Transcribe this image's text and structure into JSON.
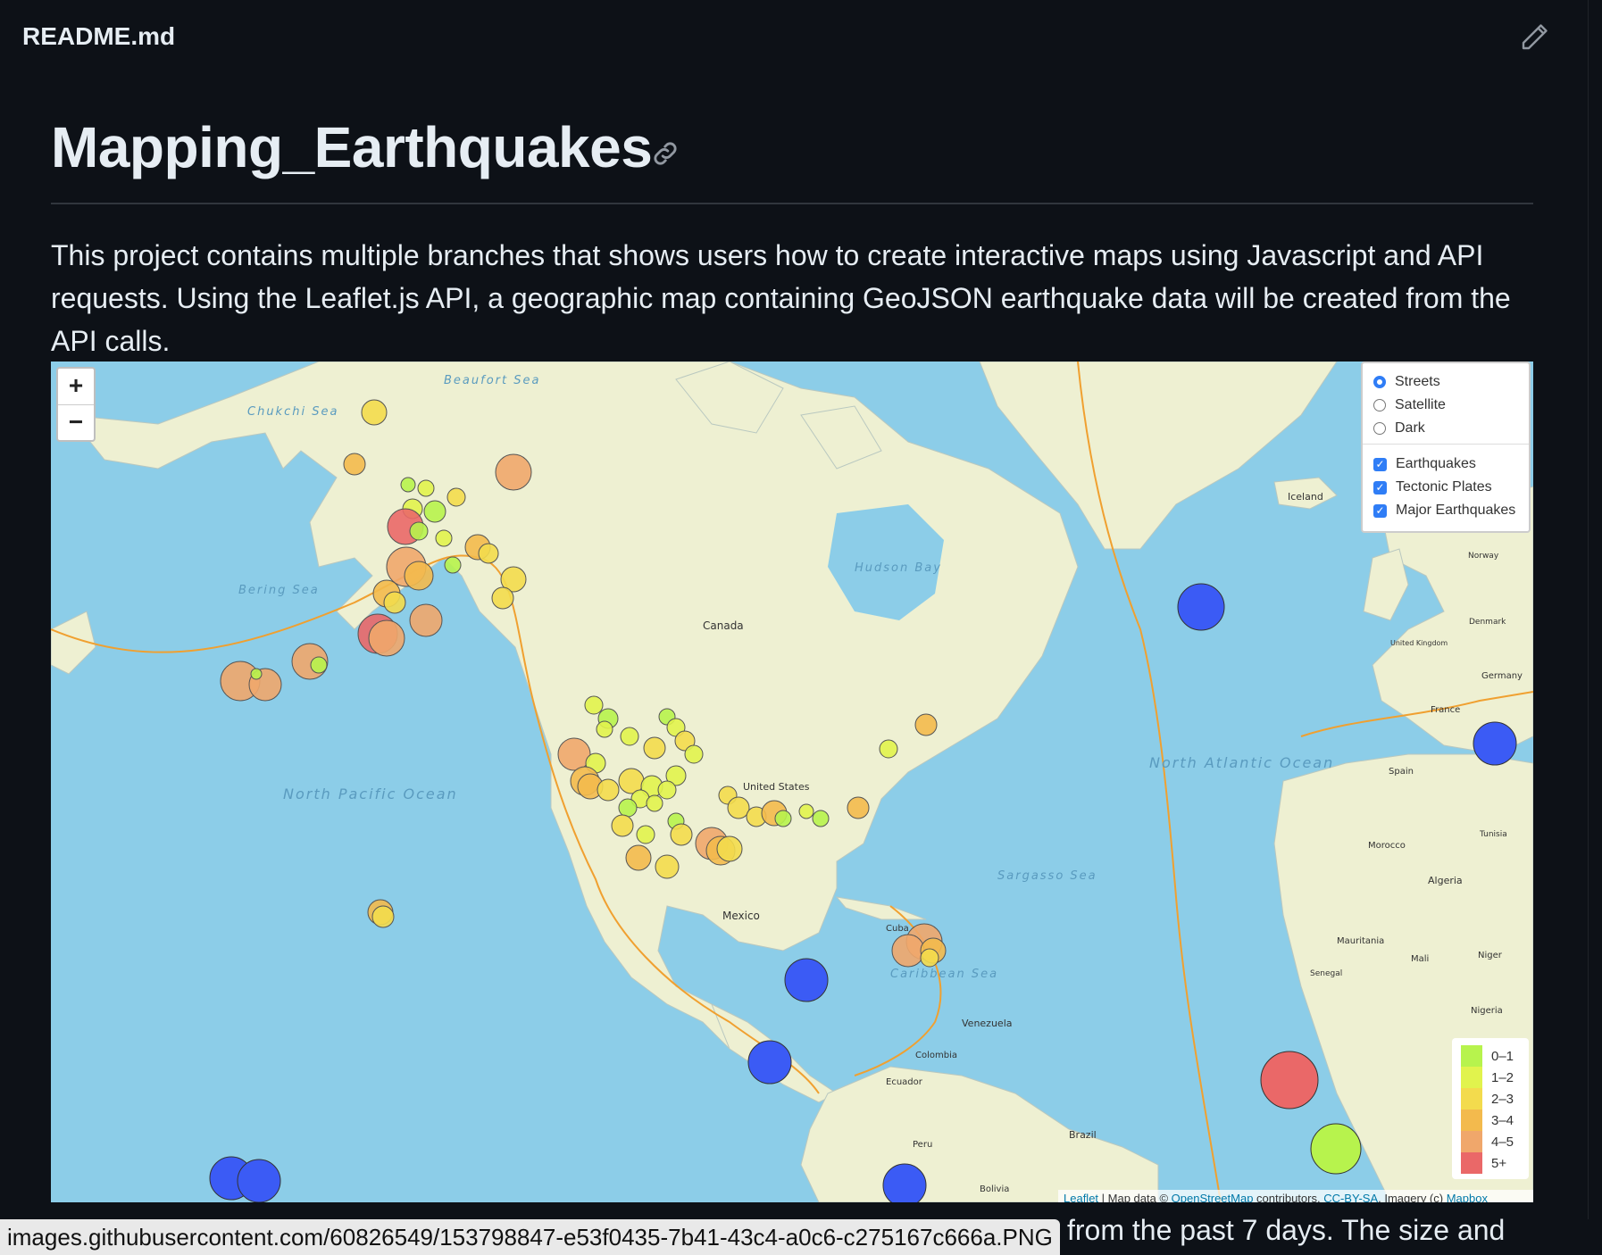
{
  "header": {
    "file_name": "README.md",
    "edit_icon": "pencil-icon"
  },
  "readme": {
    "title": "Mapping_Earthquakes",
    "anchor_icon": "link-icon",
    "intro": "This project contains multiple branches that shows users how to create interactive maps using Javascript and API requests. Using the Leaflet.js API, a geographic map containing GeoJSON earthquake data will be created from the API calls."
  },
  "map": {
    "zoom_in": "+",
    "zoom_out": "−",
    "base_layers": [
      {
        "label": "Streets",
        "selected": true
      },
      {
        "label": "Satellite",
        "selected": false
      },
      {
        "label": "Dark",
        "selected": false
      }
    ],
    "overlays": [
      {
        "label": "Earthquakes",
        "checked": true
      },
      {
        "label": "Tectonic Plates",
        "checked": true
      },
      {
        "label": "Major Earthquakes",
        "checked": true
      }
    ],
    "legend": [
      {
        "label": "0–1",
        "color": "#b7f34d"
      },
      {
        "label": "1–2",
        "color": "#e1f34d"
      },
      {
        "label": "2–3",
        "color": "#f3db4d"
      },
      {
        "label": "3–4",
        "color": "#f3ba4d"
      },
      {
        "label": "4–5",
        "color": "#f0a76b"
      },
      {
        "label": "5+",
        "color": "#ea6868"
      }
    ],
    "attribution": {
      "leaflet": "Leaflet",
      "sep": " | Map data © ",
      "osm": "OpenStreetMap",
      "contrib": " contributors, ",
      "license": "CC-BY-SA",
      "imagery": ", Imagery (c) ",
      "mapbox": "Mapbox"
    },
    "place_labels": {
      "north_pacific": "North Pacific Ocean",
      "north_atlantic": "North Atlantic Ocean",
      "bering": "Bering Sea",
      "chukchi": "Chukchi Sea",
      "beaufort": "Beaufort Sea",
      "hudson": "Hudson Bay",
      "sargasso": "Sargasso Sea",
      "caribbean": "Caribbean Sea",
      "canada": "Canada",
      "mexico": "Mexico",
      "united_states": "United States",
      "iceland": "Iceland",
      "venezuela": "Venezuela",
      "colombia": "Colombia",
      "brazil": "Brazil",
      "peru": "Peru",
      "ecuador": "Ecuador",
      "bolivia": "Bolivia",
      "cuba": "Cuba",
      "algeria": "Algeria",
      "mali": "Mali",
      "niger": "Niger",
      "nigeria": "Nigeria",
      "mauritania": "Mauritania",
      "spain": "Spain",
      "france": "France",
      "germany": "Germany",
      "morocco": "Morocco",
      "norway": "Norway",
      "united_kingdom": "United Kingdom",
      "senegal": "Senegal",
      "tunisia": "Tunisia",
      "denmark": "Denmark"
    },
    "major_quake_color": "#3b5bf5",
    "ocean_color": "#8ccde8",
    "land_color": "#eef0d2"
  },
  "status_bar": {
    "url": "images.githubusercontent.com/60826549/153798847-e53f0435-7b41-43c4-a0c6-c275167c666a.PNG"
  },
  "continuation_text": "from the past 7 days. The size and"
}
